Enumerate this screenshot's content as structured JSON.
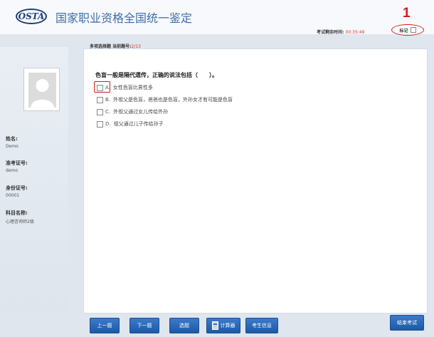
{
  "header": {
    "logo_text": "OSTA",
    "title": "国家职业资格全国统一鉴定",
    "timer_label": "考试剩余时间:",
    "timer_value": "00:35:49",
    "annotation_number": "1",
    "mark_label": "标记"
  },
  "question_info": {
    "type_label": "多项选择题",
    "current_label": "当前题号:",
    "current_value": "2/13"
  },
  "sidebar": {
    "name_label": "姓名:",
    "name_value": "Demo",
    "admission_label": "准考证号:",
    "admission_value": "demo",
    "id_label": "身份证号:",
    "id_value": "00001",
    "subject_label": "科目名称:",
    "subject_value": "心理咨询师2级"
  },
  "question": {
    "text": "色盲一般是隔代遗传，正确的说法包括（　　）。",
    "options": [
      {
        "letter": "A.",
        "text": "女性色盲比男性多"
      },
      {
        "letter": "B.",
        "text": "外祖父是色盲，爸爸也是色盲，外孙女才有可能是色盲"
      },
      {
        "letter": "C.",
        "text": "外祖父通过女儿传给外孙"
      },
      {
        "letter": "D.",
        "text": "祖父通过儿子传给孙子"
      }
    ]
  },
  "footer": {
    "prev": "上一题",
    "next": "下一题",
    "select": "选题",
    "calculator": "计算器",
    "candidate_info": "考生信息",
    "finish": "结束考试"
  },
  "colors": {
    "accent": "#2a66b3",
    "annotation": "#d21a1a",
    "title": "#3e6ea8"
  }
}
